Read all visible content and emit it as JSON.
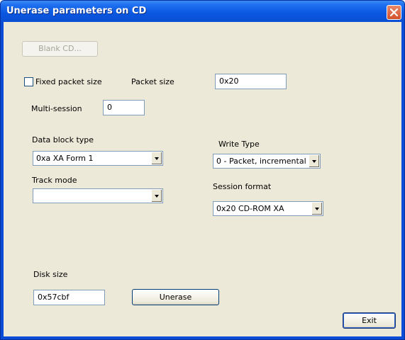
{
  "window": {
    "title": "Unerase parameters on CD"
  },
  "buttons": {
    "blank_cd": "Blank CD...",
    "unerase": "Unerase",
    "exit": "Exit"
  },
  "fixed_packet": {
    "label": "Fixed packet size",
    "checked": false
  },
  "packet_size": {
    "label": "Packet size",
    "value": "0x20"
  },
  "multi_session": {
    "label": "Multi-session",
    "value": "0"
  },
  "data_block_type": {
    "label": "Data block type",
    "value": "0xa  XA Form 1"
  },
  "write_type": {
    "label": "Write Type",
    "value": "0 - Packet, incremental"
  },
  "track_mode": {
    "label": "Track mode",
    "value": ""
  },
  "session_format": {
    "label": "Session format",
    "value": "0x20  CD-ROM XA"
  },
  "disk_size": {
    "label": "Disk size",
    "value": "0x57cbf"
  }
}
